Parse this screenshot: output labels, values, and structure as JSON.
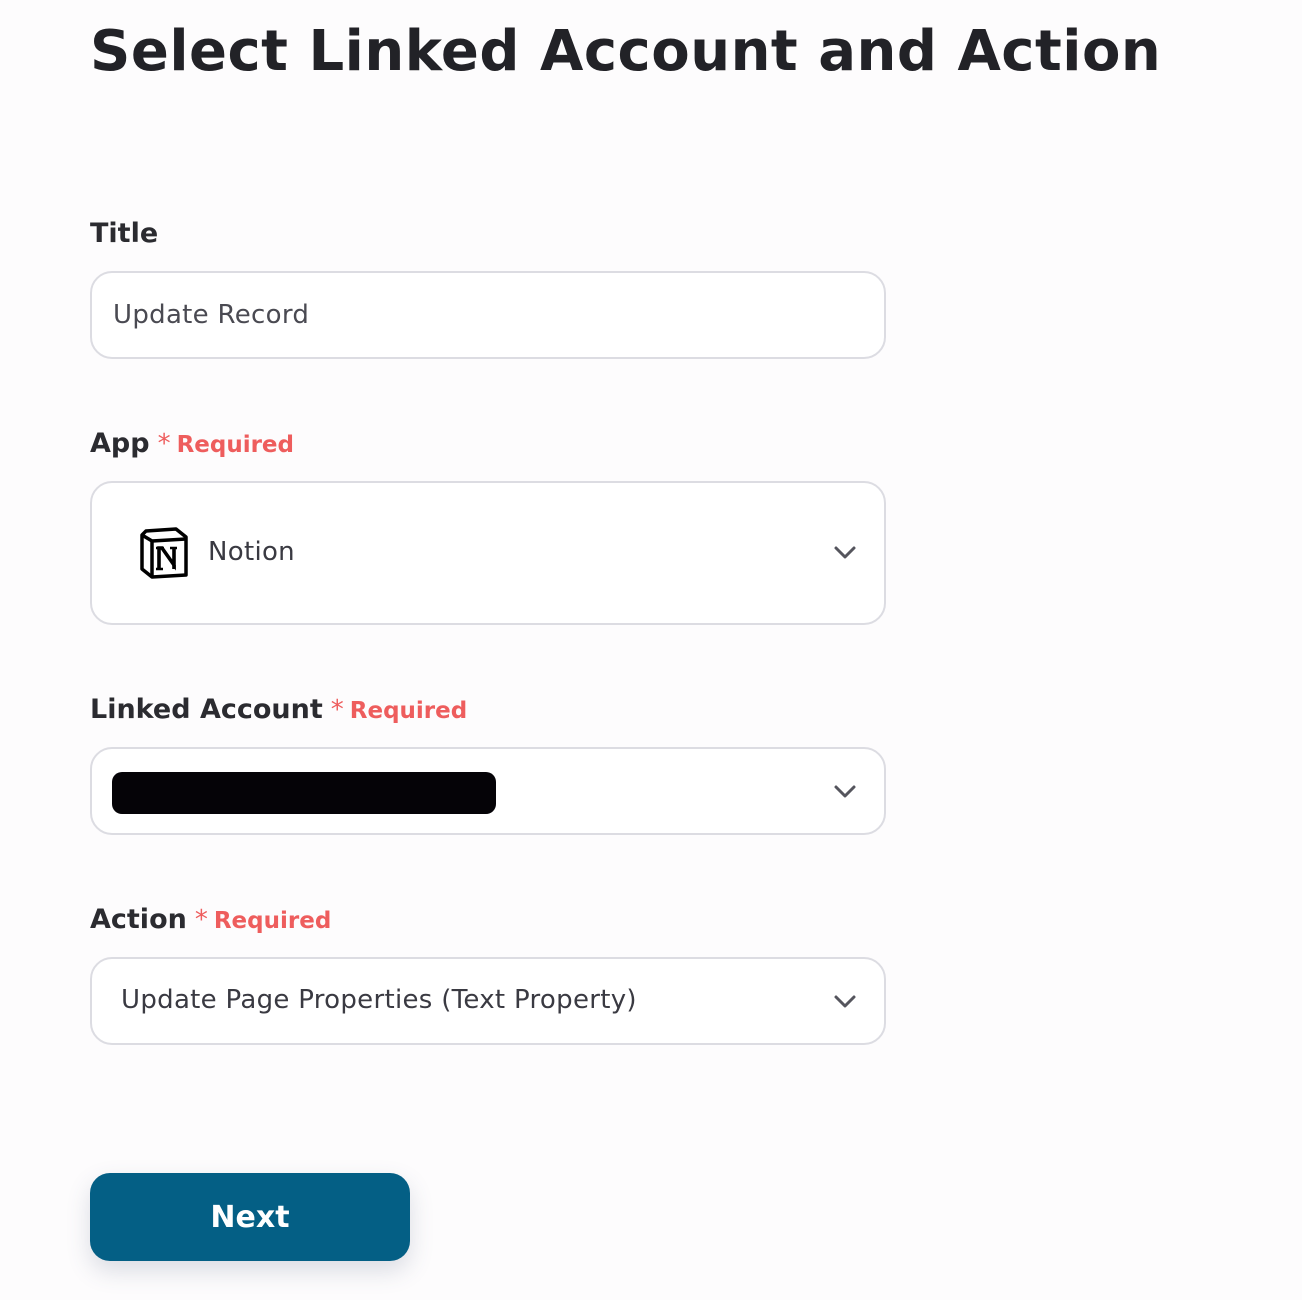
{
  "page": {
    "title": "Select Linked Account and Action"
  },
  "fields": {
    "title": {
      "label": "Title",
      "value": "Update Record"
    },
    "app": {
      "label": "App",
      "required_mark": "*",
      "required_text": "Required",
      "selected": "Notion",
      "icon": "notion-logo"
    },
    "linked_account": {
      "label": "Linked Account",
      "required_mark": "*",
      "required_text": "Required",
      "selected_redacted": true
    },
    "action": {
      "label": "Action",
      "required_mark": "*",
      "required_text": "Required",
      "selected": "Update Page Properties (Text Property)"
    }
  },
  "footer": {
    "next_label": "Next"
  },
  "colors": {
    "required": "#ee5d5d",
    "primary_button": "#045f85",
    "field_border": "#dcdce2"
  }
}
